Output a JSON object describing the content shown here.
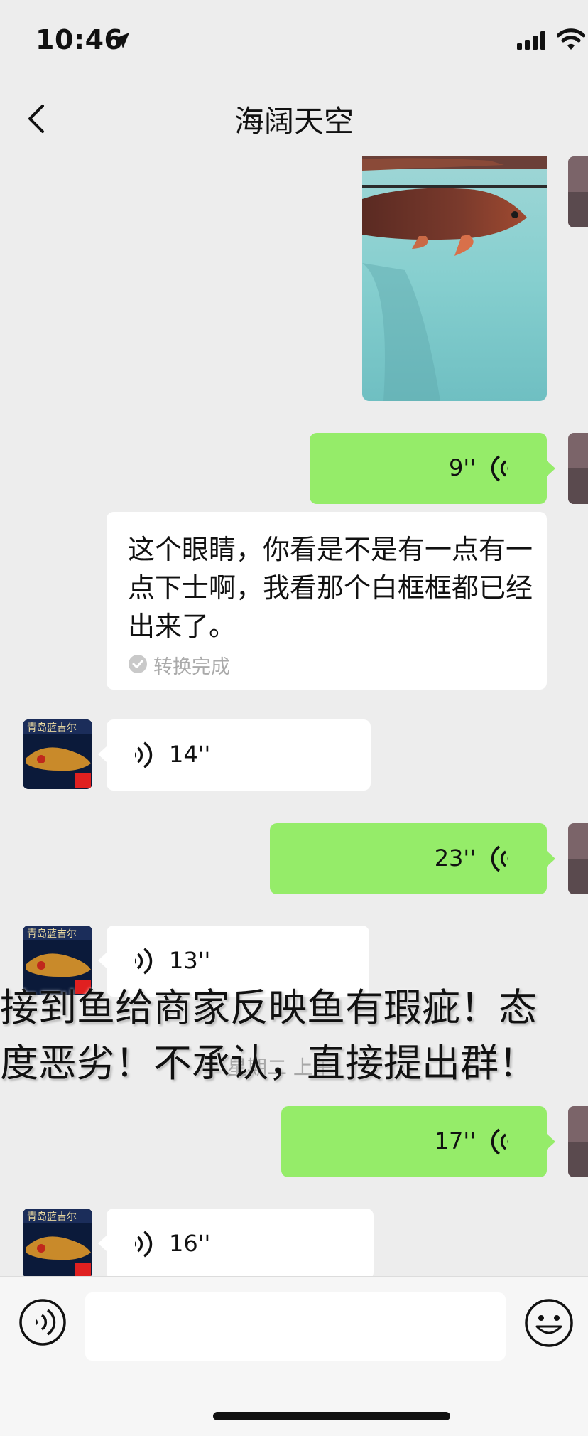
{
  "status_bar": {
    "time": "10:46"
  },
  "header": {
    "title": "海阔天空"
  },
  "messages": [
    {
      "side": "right",
      "kind": "image"
    },
    {
      "side": "right",
      "kind": "voice",
      "duration": "9''"
    },
    {
      "side": "right",
      "kind": "transcript",
      "text": "这个眼睛，你看是不是有一点有一点下士啊，我看那个白框框都已经出来了。",
      "status": "转换完成"
    },
    {
      "side": "left",
      "kind": "voice",
      "duration": "14''"
    },
    {
      "side": "right",
      "kind": "voice",
      "duration": "23''"
    },
    {
      "side": "left",
      "kind": "voice",
      "duration": "13''"
    },
    {
      "side": "right",
      "kind": "voice",
      "duration": "17''"
    },
    {
      "side": "left",
      "kind": "voice",
      "duration": "16''"
    }
  ],
  "timestamp": "星期二 上午",
  "overlay_caption": {
    "line1": "接到鱼给商家反映鱼有瑕疵！态",
    "line2": "度恶劣！不承认，直接提出群！"
  },
  "colors": {
    "outgoing_bubble": "#95ec69",
    "incoming_bubble": "#ffffff",
    "background": "#ededed"
  },
  "icons": [
    "location-arrow-icon",
    "signal-icon",
    "wifi-icon",
    "back-chevron-icon",
    "voice-wave-icon",
    "check-circle-icon",
    "voice-input-icon",
    "emoji-icon"
  ]
}
